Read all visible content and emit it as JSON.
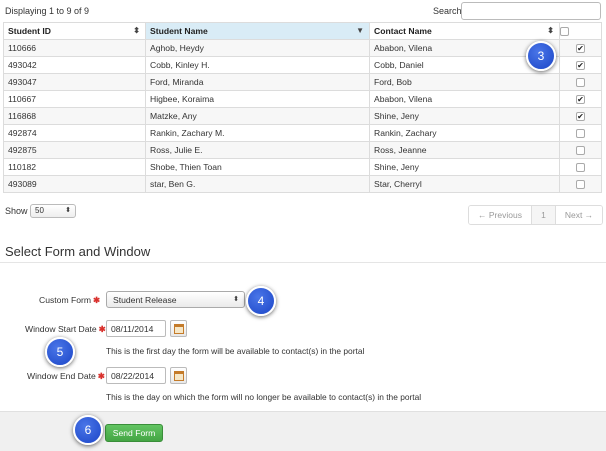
{
  "top": {
    "displaying": "Displaying 1 to 9 of 9",
    "search_label": "Search"
  },
  "table": {
    "columns": [
      "Student ID",
      "Student Name",
      "Contact Name"
    ],
    "rows": [
      {
        "id": "110666",
        "name": "Aghob, Heydy",
        "contact": "Ababon, Vilena",
        "checked": true
      },
      {
        "id": "493042",
        "name": "Cobb, Kinley H.",
        "contact": "Cobb, Daniel",
        "checked": true
      },
      {
        "id": "493047",
        "name": "Ford, Miranda",
        "contact": "Ford, Bob",
        "checked": false
      },
      {
        "id": "110667",
        "name": "Higbee, Koraima",
        "contact": "Ababon, Vilena",
        "checked": true
      },
      {
        "id": "116868",
        "name": "Matzke, Any",
        "contact": "Shine, Jeny",
        "checked": true
      },
      {
        "id": "492874",
        "name": "Rankin, Zachary M.",
        "contact": "Rankin, Zachary",
        "checked": false
      },
      {
        "id": "492875",
        "name": "Ross, Julie E.",
        "contact": "Ross, Jeanne",
        "checked": false
      },
      {
        "id": "110182",
        "name": "Shobe, Thien Toan",
        "contact": "Shine, Jeny",
        "checked": false
      },
      {
        "id": "493089",
        "name": "star, Ben G.",
        "contact": "Star, Cherryl",
        "checked": false
      }
    ]
  },
  "show": {
    "label": "Show",
    "value": "50"
  },
  "pager": {
    "prev": "← Previous",
    "page": "1",
    "next": "Next →"
  },
  "section": {
    "title": "Select Form and Window"
  },
  "form": {
    "custom_form_label": "Custom Form",
    "custom_form_value": "Student Release",
    "start_label": "Window Start Date",
    "start_value": "08/11/2014",
    "start_help": "This is the first day the form will be available to contact(s) in the portal",
    "end_label": "Window End Date",
    "end_value": "08/22/2014",
    "end_help": "This is the day on which the form will no longer be available to contact(s) in the portal",
    "required_mark": "✱"
  },
  "footer": {
    "send_label": "Send Form"
  },
  "callouts": [
    "3",
    "4",
    "5",
    "6"
  ],
  "colors": {
    "callout": "#1b45c7",
    "send_button": "#44a544",
    "required": "#d9302c",
    "sorted_header": "#d9ecf6"
  }
}
